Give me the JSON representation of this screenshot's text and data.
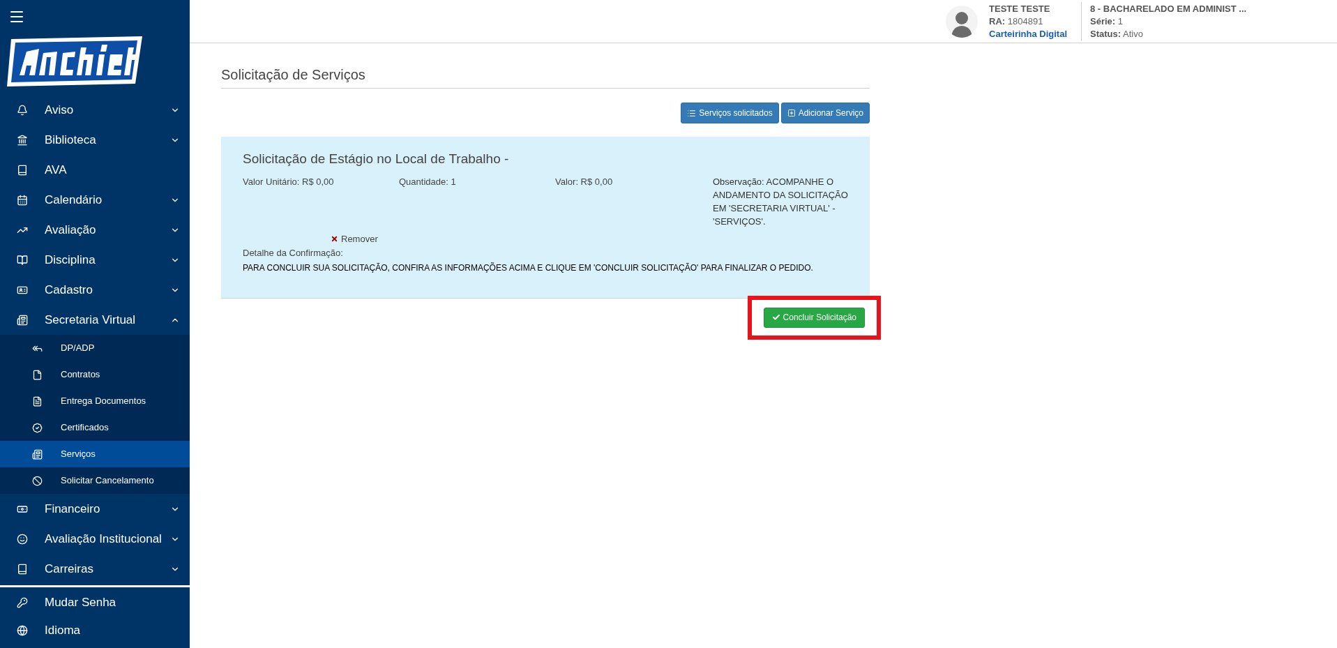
{
  "sidebar": {
    "items": [
      {
        "label": "Aviso",
        "kind": "group",
        "expanded": false
      },
      {
        "label": "Biblioteca",
        "kind": "group",
        "expanded": false
      },
      {
        "label": "AVA",
        "kind": "link"
      },
      {
        "label": "Calendário",
        "kind": "group",
        "expanded": false
      },
      {
        "label": "Avaliação",
        "kind": "group",
        "expanded": false
      },
      {
        "label": "Disciplina",
        "kind": "group",
        "expanded": false
      },
      {
        "label": "Cadastro",
        "kind": "group",
        "expanded": false
      },
      {
        "label": "Secretaria Virtual",
        "kind": "group",
        "expanded": true,
        "children": [
          {
            "label": "DP/ADP",
            "selected": false
          },
          {
            "label": "Contratos",
            "selected": false
          },
          {
            "label": "Entrega Documentos",
            "selected": false
          },
          {
            "label": "Certificados",
            "selected": false
          },
          {
            "label": "Serviços",
            "selected": true
          },
          {
            "label": "Solicitar Cancelamento",
            "selected": false
          }
        ]
      },
      {
        "label": "Financeiro",
        "kind": "group",
        "expanded": false
      },
      {
        "label": "Avaliação Institucional",
        "kind": "group",
        "expanded": false
      },
      {
        "label": "Carreiras",
        "kind": "group",
        "expanded": false
      }
    ],
    "account_items": [
      {
        "label": "Mudar Senha"
      },
      {
        "label": "Idioma"
      }
    ]
  },
  "header": {
    "user": {
      "name": "TESTE TESTE",
      "ra_label": "RA:",
      "ra": "1804891",
      "link": "Carteirinha Digital"
    },
    "course": {
      "name": "8 - BACHARELADO EM ADMINIST ...",
      "serie_label": "Série:",
      "serie": "1",
      "status_label": "Status:",
      "status": "Ativo"
    }
  },
  "page": {
    "title": "Solicitação de Serviços",
    "buttons": [
      {
        "label": "Serviços solicitados",
        "kind": "list"
      },
      {
        "label": "Adicionar Serviço",
        "kind": "add"
      }
    ],
    "request": {
      "title": "Solicitação de Estágio no Local de Trabalho -",
      "unit_value": "Valor Unitário: R$ 0,00",
      "quantity": "Quantidade: 1",
      "value": "Valor: R$ 0,00",
      "note": "Observação: ACOMPANHE O ANDAMENTO DA SOLICITAÇÃO EM 'SECRETARIA VIRTUAL' - 'SERVIÇOS'.",
      "remove": "Remover",
      "detail_label": "Detalhe da Confirmação:",
      "detail": "PARA CONCLUIR SUA SOLICITAÇÃO, CONFIRA AS INFORMAÇÕES ACIMA E CLIQUE EM 'CONCLUIR SOLICITAÇÃO' PARA FINALIZAR O PEDIDO."
    },
    "submit": {
      "label": "Concluir Solicitação",
      "highlighted": true
    }
  }
}
